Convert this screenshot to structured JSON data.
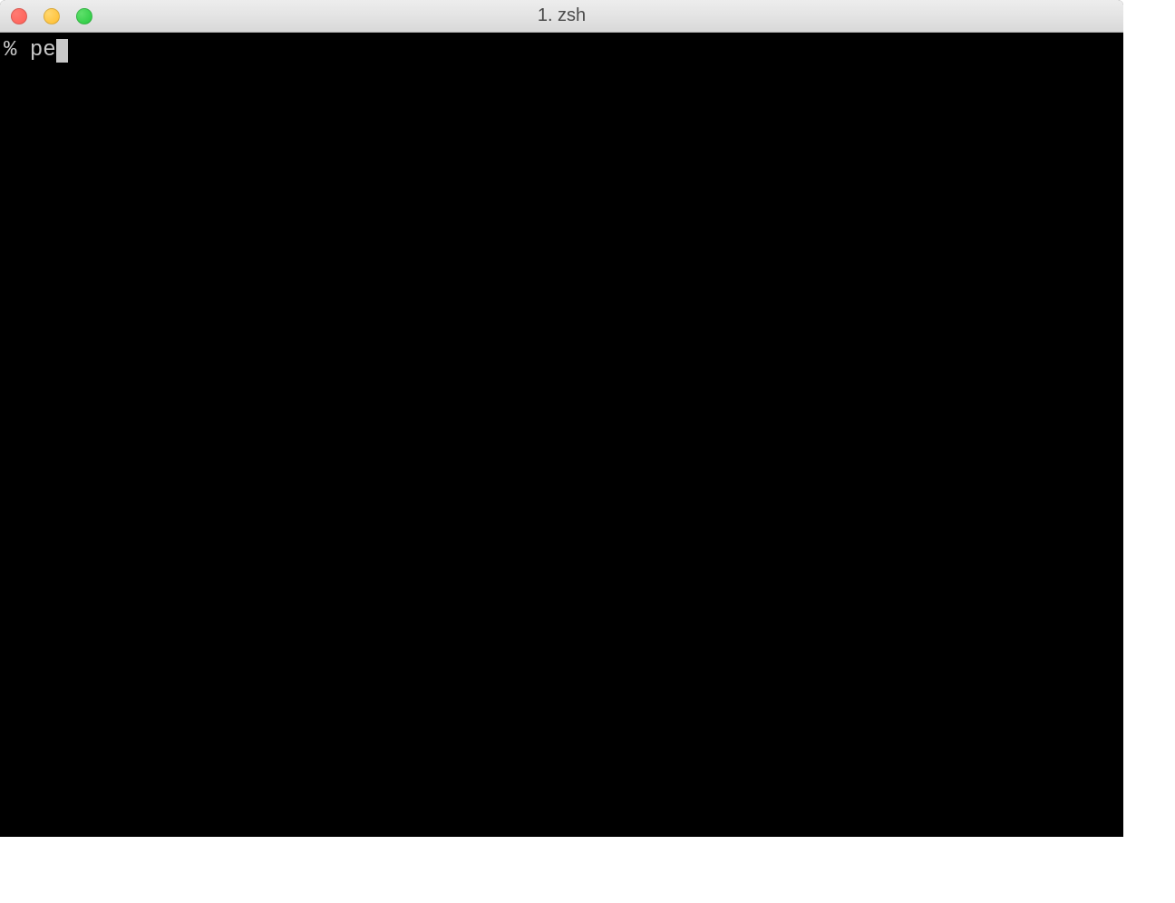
{
  "window": {
    "title": "1. zsh"
  },
  "terminal": {
    "prompt": "% ",
    "command": "pe"
  }
}
